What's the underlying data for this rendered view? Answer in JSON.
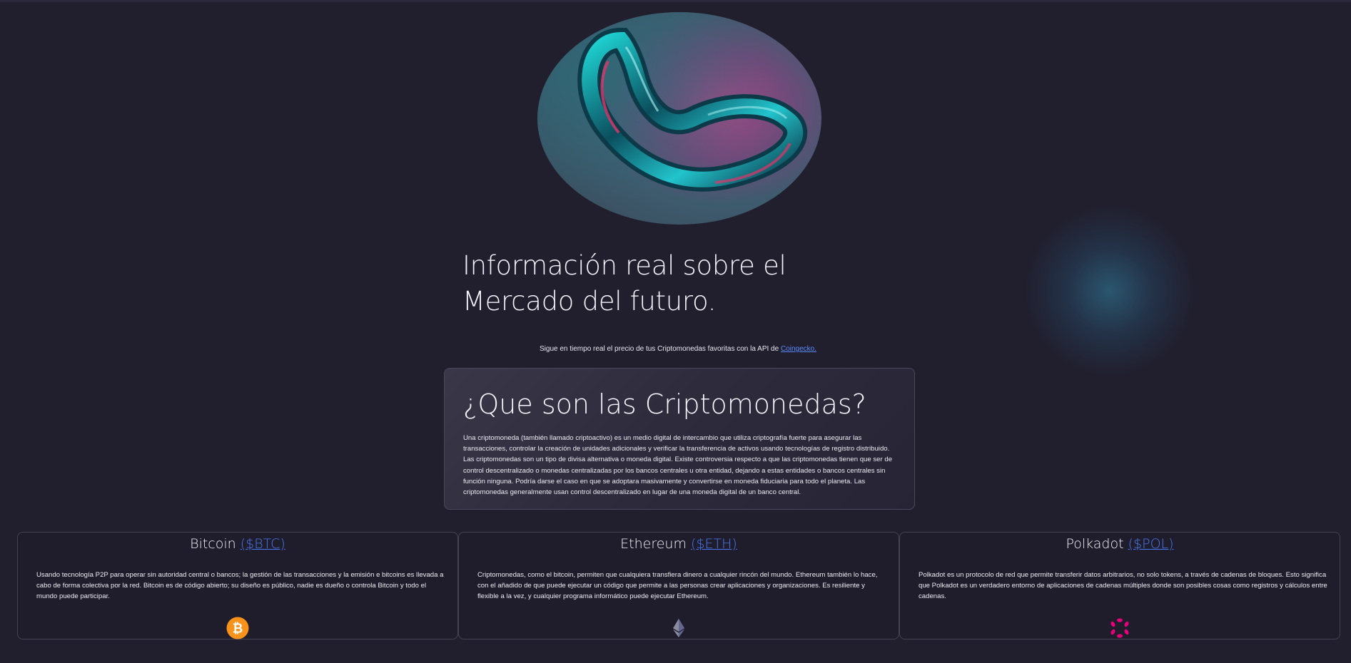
{
  "hero": {
    "title": "Información real sobre el Mercado del futuro.",
    "subtitle_prefix": "Sigue en tiempo real el precio de tus Criptomonedas favoritas con la API de",
    "subtitle_link": "Coingecko."
  },
  "about": {
    "heading": "¿Que son las Criptomonedas?",
    "body": "Una criptomoneda (también llamado criptoactivo) es un medio digital de intercambio que utiliza criptografía fuerte para asegurar las transacciones, controlar la creación de unidades adicionales y verificar la transferencia de activos usando tecnologías de registro distribuido. Las criptomonedas son un tipo de divisa alternativa o moneda digital. Existe controversia respecto a que las criptomonedas tienen que ser de control descentralizado o monedas centralizadas por los bancos centrales u otra entidad, dejando a estas entidades o bancos centrales sin función ninguna. Podría darse el caso en que se adoptara masivamente y convertirse en moneda fiduciaria para todo el planeta. Las criptomonedas generalmente usan control descentralizado en lugar de una moneda digital de un banco central."
  },
  "coins": [
    {
      "name": "Bitcoin",
      "ticker": "($BTC)",
      "icon": "bitcoin-icon",
      "description": "Usando tecnología P2P para operar sin autoridad central o bancos; la gestión de las transacciones y la emisión e bitcoins es llevada a cabo de forma colectiva por la red. Bitcoin es de código abierto; su diseño es público, nadie es dueño o controla Bitcoin y todo el mundo puede participar."
    },
    {
      "name": "Ethereum",
      "ticker": "($ETH)",
      "icon": "ethereum-icon",
      "description": "Criptomonedas, como el bitcoin, permiten que cualquiera transfiera dinero a cualquier rincón del mundo. Ethereum también lo hace, con el añadido de que puede ejecutar un código que permite a las personas crear aplicaciones y organizaciones. Es resiliente y flexible a la vez, y cualquier programa informático puede ejecutar Ethereum."
    },
    {
      "name": "Polkadot",
      "ticker": "($POL)",
      "icon": "polkadot-icon",
      "description": "Polkadot es un protocolo de red que permite transferir datos arbitrarios, no solo tokens, a través de cadenas de bloques. Esto significa que Polkadot es un verdadero entorno de aplicaciones de cadenas múltiples donde son posibles cosas como registros y cálculos entre cadenas."
    }
  ],
  "colors": {
    "background": "#211f2e",
    "link": "#4a78f0",
    "bitcoin": "#f7931a",
    "polkadot": "#e6007a",
    "ethereum": "#8c8ca1"
  }
}
